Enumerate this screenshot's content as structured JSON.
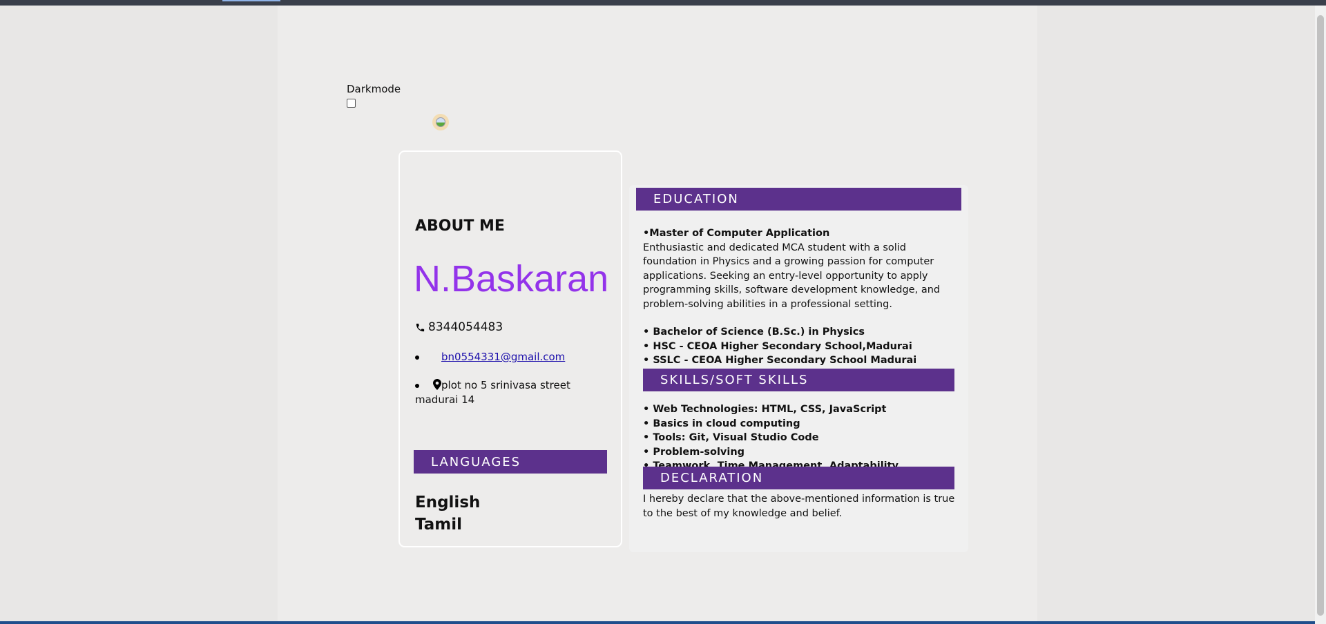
{
  "darkmode": {
    "label": "Darkmode",
    "checked": false
  },
  "profile": {
    "about_title": "ABOUT ME",
    "name": "N.Baskaran",
    "phone": "8344054483",
    "email": "bn0554331@gmail.com",
    "address": "plot no 5 srinivasa street madurai 14",
    "languages_title": "LANGUAGES",
    "languages": [
      "English",
      "Tamil"
    ]
  },
  "education": {
    "title": "EDUCATION",
    "mca_title": "•Master of Computer Application",
    "mca_desc": "Enthusiastic and dedicated MCA student with a solid foundation in Physics and a growing passion for computer applications. Seeking an entry-level opportunity to apply programming skills, software development knowledge, and problem-solving abilities in a professional setting.",
    "items": [
      "• Bachelor of Science (B.Sc.) in Physics",
      "• HSC - CEOA Higher Secondary School,Madurai",
      "• SSLC - CEOA Higher Secondary School Madurai"
    ]
  },
  "skills": {
    "title": "SKILLS/SOFT SKILLS",
    "items": [
      "• Web Technologies: HTML, CSS, JavaScript",
      "• Basics in cloud computing",
      "• Tools: Git, Visual Studio Code",
      "• Problem-solving",
      "• Teamwork, Time Management, Adaptability"
    ]
  },
  "declaration": {
    "title": "DECLARATION",
    "text": "I hereby declare that the above-mentioned information is true to the best of my knowledge and belief."
  },
  "colors": {
    "accent": "#5c318c",
    "name": "#9333ea",
    "link": "#1a0dab"
  }
}
